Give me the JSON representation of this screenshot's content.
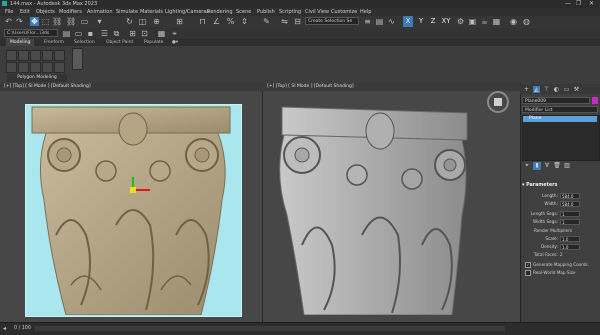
{
  "window": {
    "title": "144.max - Autodesk 3ds Max 2023",
    "controls": [
      "—",
      "❐",
      "✕"
    ]
  },
  "menu": [
    "File",
    "Edit",
    "Objects",
    "Modifiers",
    "Animation",
    "Simulate",
    "Materials",
    "Lighting/Cameras",
    "Rendering",
    "Scene",
    "Publish",
    "Scripting",
    "Civil View",
    "Customize",
    "Help"
  ],
  "toolbar": {
    "selection_set": "Create Selection Se",
    "axis": [
      "X",
      "Y",
      "Z",
      "XY"
    ],
    "workspace": "C:\\Users\\Flor...\\3ds Max 2023"
  },
  "ribbon": {
    "tabs": [
      "Modeling",
      "Freeform",
      "Selection",
      "Object Paint",
      "Populate"
    ],
    "group_label": "Polygon Modeling"
  },
  "viewport": {
    "label": "[+] [Top] [ SI Mode ] [Default Shading]",
    "label2": "[+] [Top] [ SI Mode ] [Default Shading]"
  },
  "command_panel": {
    "object_name": "Plane009",
    "modifier_list": "Modifier List",
    "stack_item": "Plane",
    "rollout": "Parameters",
    "params": [
      {
        "label": "Length:",
        "value": "584.0"
      },
      {
        "label": "Width:",
        "value": "584.0"
      },
      {
        "label": "Length Segs:",
        "value": "1"
      },
      {
        "label": "Width Segs:",
        "value": "1"
      },
      {
        "label": "Render Multipliers",
        "value": ""
      },
      {
        "label": "Scale:",
        "value": "1.0"
      },
      {
        "label": "Density:",
        "value": "1.0"
      },
      {
        "label": "Total Faces:",
        "value": "2"
      }
    ],
    "checks": [
      {
        "label": "Generate Mapping Coords.",
        "checked": "✓"
      },
      {
        "label": "Real-World Map Size",
        "checked": ""
      }
    ]
  },
  "status": {
    "coord": "0 / 100"
  },
  "colors": {
    "selected_object": "#c92bc7",
    "active_blue": "#3d7bb6",
    "highlight_blue": "#5d9fd8"
  }
}
